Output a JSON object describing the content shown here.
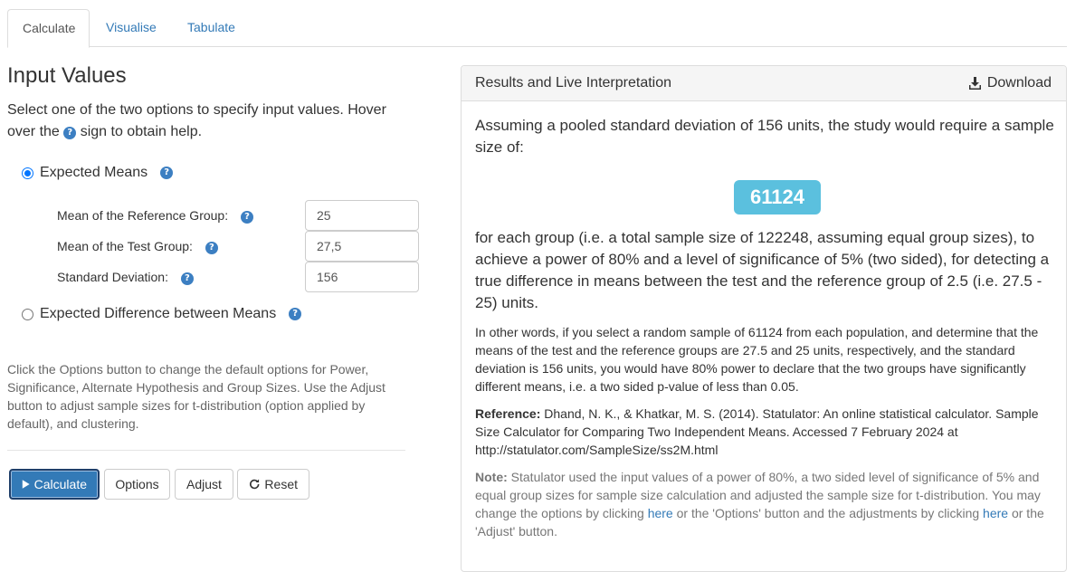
{
  "tabs": [
    {
      "label": "Calculate",
      "active": true
    },
    {
      "label": "Visualise",
      "active": false
    },
    {
      "label": "Tabulate",
      "active": false
    }
  ],
  "left": {
    "heading": "Input Values",
    "intro_part1": "Select one of the two options to specify input values. Hover over the",
    "intro_part2": "sign to obtain help.",
    "option_means_label": "Expected Means",
    "option_diff_label": "Expected Difference between Means",
    "fields": [
      {
        "label": "Mean of the Reference Group:",
        "value": "25"
      },
      {
        "label": "Mean of the Test Group:",
        "value": "27,5"
      },
      {
        "label": "Standard Deviation:",
        "value": "156"
      }
    ],
    "help_text": "Click the Options button to change the default options for Power, Significance, Alternate Hypothesis and Group Sizes. Use the Adjust button to adjust sample sizes for t-distribution (option applied by default), and clustering.",
    "buttons": {
      "calculate": "Calculate",
      "options": "Options",
      "adjust": "Adjust",
      "reset": "Reset"
    }
  },
  "results": {
    "title": "Results and Live Interpretation",
    "download_label": "Download",
    "para1": "Assuming a pooled standard deviation of 156 units, the study would require a sample size of:",
    "sample_size": "61124",
    "para2": "for each group (i.e. a total sample size of 122248, assuming equal group sizes), to achieve a power of 80% and a level of significance of 5% (two sided), for detecting a true difference in means between the test and the reference group of 2.5 (i.e. 27.5 - 25) units.",
    "para3": "In other words, if you select a random sample of 61124 from each population, and determine that the means of the test and the reference groups are 27.5 and 25 units, respectively, and the standard deviation is 156 units, you would have 80% power to declare that the two groups have significantly different means, i.e. a two sided p-value of less than 0.05.",
    "reference_label": "Reference:",
    "reference_text": "Dhand, N. K., & Khatkar, M. S. (2014). Statulator: An online statistical calculator. Sample Size Calculator for Comparing Two Independent Means. Accessed 7 February 2024 at http://statulator.com/SampleSize/ss2M.html",
    "note_label": "Note:",
    "note_part1": "Statulator used the input values of a power of 80%, a two sided level of significance of 5% and equal group sizes for sample size calculation and adjusted the sample size for t-distribution. You may change the options by clicking",
    "note_link1": "here",
    "note_part2": "or the 'Options' button and the adjustments by clicking",
    "note_link2": "here",
    "note_part3": "or the 'Adjust' button."
  },
  "icons": {
    "help": "question-circle-icon",
    "play": "play-icon",
    "refresh": "refresh-icon",
    "download": "download-icon"
  },
  "colors": {
    "link": "#337ab7",
    "primary_button": "#337ab7",
    "badge": "#5bc0de",
    "help_icon": "#3c7fc2"
  }
}
